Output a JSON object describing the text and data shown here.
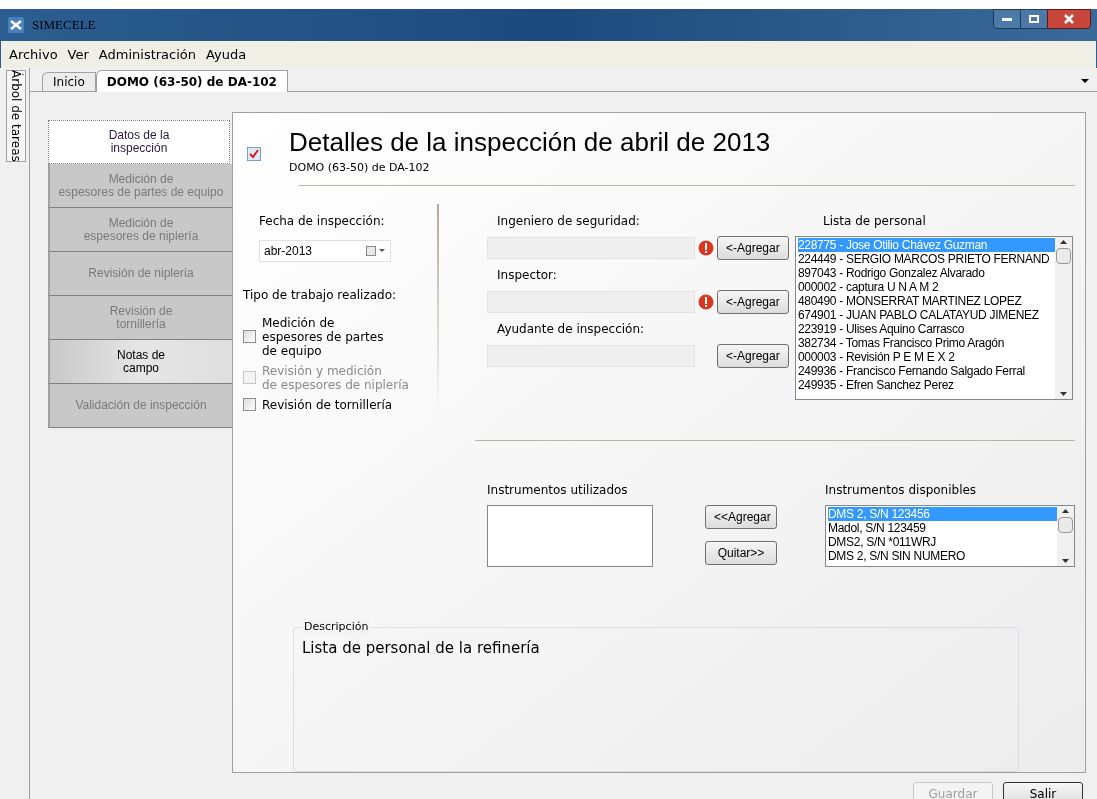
{
  "window": {
    "title": "SIMECELE"
  },
  "menu": [
    "Archivo",
    "Ver",
    "Administración",
    "Ayuda"
  ],
  "side_tab": {
    "label": "Árbol de tareas"
  },
  "tabs": [
    {
      "label": "Inicio",
      "selected": false
    },
    {
      "label": "DOMO (63-50) de DA-102",
      "selected": true
    }
  ],
  "nav": [
    {
      "label": "Datos de la\ninspección",
      "selected": true,
      "disabled": false
    },
    {
      "label": "Medición de\nespesores de partes de equipo",
      "selected": false,
      "disabled": true
    },
    {
      "label": "Medición de\nespesores de niplería",
      "selected": false,
      "disabled": true
    },
    {
      "label": "Revisión de niplería",
      "selected": false,
      "disabled": true
    },
    {
      "label": "Revisión de\ntornillería",
      "selected": false,
      "disabled": true
    },
    {
      "label": "Notas de\ncampo",
      "selected": false,
      "disabled": false
    },
    {
      "label": "Validación de inspección",
      "selected": false,
      "disabled": true
    }
  ],
  "header": {
    "title": "Detalles de la inspección de abril de 2013",
    "subtitle": "DOMO (63-50) de DA-102"
  },
  "date": {
    "label": "Fecha de inspección:",
    "value": "abr-2013"
  },
  "work_type": {
    "label": "Tipo de trabajo realizado:",
    "options": [
      {
        "label": "Medición de\nespesores de partes\nde equipo",
        "checked": false,
        "disabled": false
      },
      {
        "label": "Revisión y medición\nde espesores de niplería",
        "checked": false,
        "disabled": true
      },
      {
        "label": "Revisión de tornillería",
        "checked": false,
        "disabled": false
      }
    ]
  },
  "people_fields": [
    {
      "label": "Ingeniero de seguridad:",
      "error": true,
      "button": "<-Agregar"
    },
    {
      "label": "Inspector:",
      "error": true,
      "button": "<-Agregar"
    },
    {
      "label": "Ayudante de inspección:",
      "error": false,
      "button": "<-Agregar"
    }
  ],
  "personnel": {
    "label": "Lista de personal",
    "items": [
      {
        "text": "228775 - Jose Otilio Chávez Guzman",
        "selected": true
      },
      {
        "text": "224449 - SERGIO MARCOS PRIETO FERNAND",
        "selected": false
      },
      {
        "text": "897043 - Rodrigo Gonzalez Alvarado",
        "selected": false
      },
      {
        "text": "000002 - captura U N A M 2",
        "selected": false
      },
      {
        "text": "480490 - MONSERRAT MARTINEZ LOPEZ",
        "selected": false
      },
      {
        "text": "674901 - JUAN PABLO CALATAYUD JIMENEZ",
        "selected": false
      },
      {
        "text": "223919 - Ulises Aquino Carrasco",
        "selected": false
      },
      {
        "text": "382734 - Tomas Francisco Primo Aragón",
        "selected": false
      },
      {
        "text": "000003 - Revisión P E M E X 2",
        "selected": false
      },
      {
        "text": "249936 - Francisco Fernando Salgado Ferral",
        "selected": false
      },
      {
        "text": "249935 - Efren Sanchez Perez",
        "selected": false
      }
    ]
  },
  "instruments_used": {
    "label": "Instrumentos utilizados"
  },
  "instrument_buttons": [
    "<<Agregar",
    "Quitar>>"
  ],
  "instruments_available": {
    "label": "Instrumentos disponibles",
    "items": [
      {
        "text": "DMS 2, S/N 123456",
        "selected": true
      },
      {
        "text": "Madol, S/N 123459",
        "selected": false
      },
      {
        "text": "DMS2, S/N *011WRJ",
        "selected": false
      },
      {
        "text": "DMS 2, S/N SIN NUMERO",
        "selected": false
      }
    ]
  },
  "description": {
    "label": "Descripción",
    "value": "Lista de personal de la refinería"
  },
  "footer_buttons": [
    {
      "label": "Guardar",
      "disabled": true
    },
    {
      "label": "Salir",
      "disabled": false
    }
  ]
}
